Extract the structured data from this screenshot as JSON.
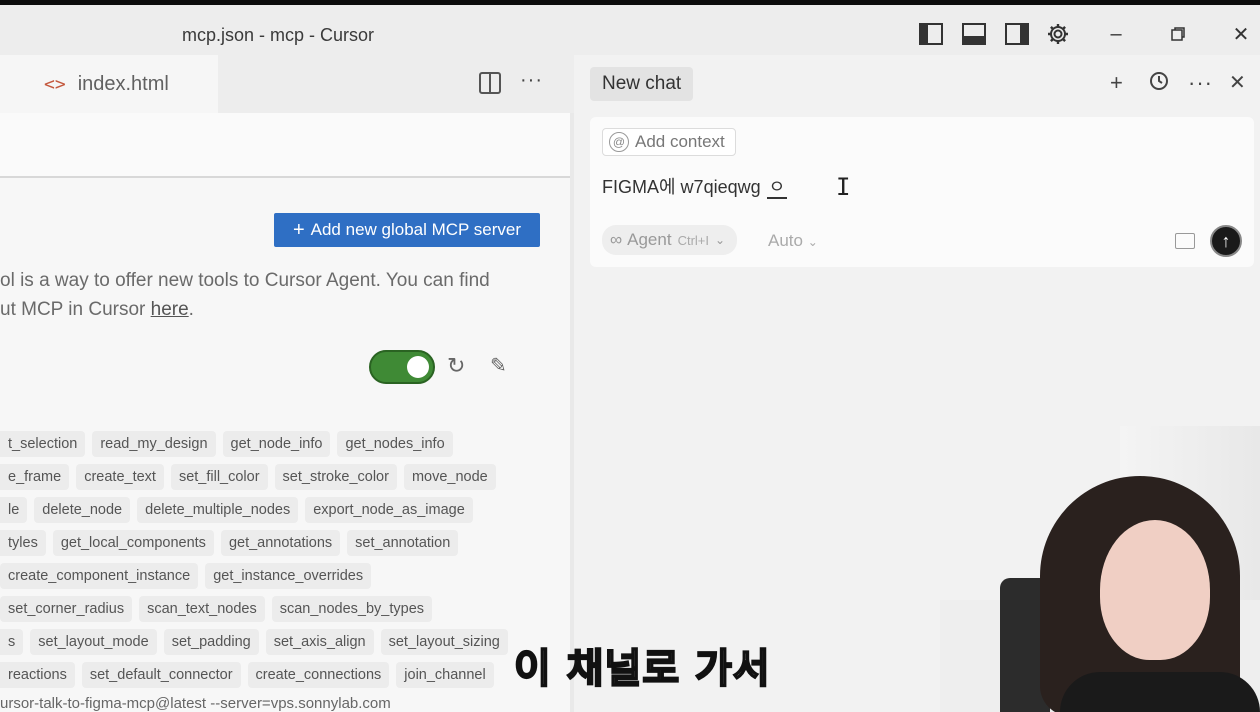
{
  "window": {
    "title": "mcp.json - mcp - Cursor"
  },
  "editor": {
    "tab_label": "index.html",
    "add_server_label": "Add new global MCP server",
    "description_text": "ol is a way to offer new tools to Cursor Agent. You can find",
    "description_text2": "ut MCP in Cursor ",
    "description_link": "here",
    "description_end": ".",
    "server_enabled": true,
    "tool_rows": [
      [
        "t_selection",
        "read_my_design",
        "get_node_info",
        "get_nodes_info"
      ],
      [
        "e_frame",
        "create_text",
        "set_fill_color",
        "set_stroke_color",
        "move_node"
      ],
      [
        "le",
        "delete_node",
        "delete_multiple_nodes",
        "export_node_as_image"
      ],
      [
        "tyles",
        "get_local_components",
        "get_annotations",
        "set_annotation"
      ],
      [
        "",
        "create_component_instance",
        "get_instance_overrides"
      ],
      [
        "set_corner_radius",
        "scan_text_nodes",
        "scan_nodes_by_types"
      ],
      [
        "s",
        "set_layout_mode",
        "set_padding",
        "set_axis_align",
        "set_layout_sizing"
      ],
      [
        "reactions",
        "set_default_connector",
        "create_connections",
        "join_channel"
      ]
    ],
    "command": "ursor-talk-to-figma-mcp@latest --server=vps.sonnylab.com"
  },
  "chat": {
    "tab_label": "New chat",
    "add_context_label": "Add context",
    "prompt_text": "FIGMA에  w7qieqwg",
    "composing_char": "ㅇ",
    "agent_label": "Agent",
    "agent_shortcut": "Ctrl+I",
    "model_label": "Auto"
  },
  "video": {
    "subtitle": "이 채널로 가서"
  },
  "icons": [
    "toggle-sidebar-icon",
    "toggle-panel-icon",
    "toggle-secondary-sidebar-icon",
    "gear-icon",
    "minimize-icon",
    "restore-icon",
    "close-icon",
    "split-editor-icon",
    "more-icon",
    "plus-icon",
    "history-icon",
    "image-icon",
    "send-icon",
    "refresh-icon",
    "pencil-icon"
  ],
  "colors": {
    "accent": "#2f6fc4",
    "toggle_on": "#3f8a35",
    "send_button": "#1a1a1a"
  }
}
